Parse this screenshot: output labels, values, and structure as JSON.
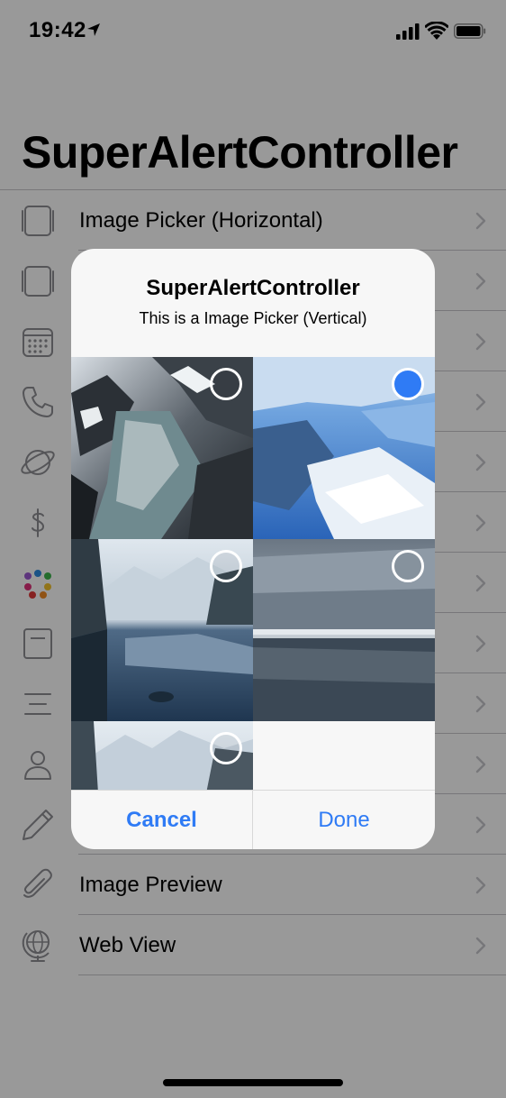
{
  "status_bar": {
    "time": "19:42"
  },
  "nav": {
    "title": "SuperAlertController"
  },
  "list": [
    {
      "label": "Image Picker (Horizontal)",
      "icon": "square-stack-icon"
    },
    {
      "label": "",
      "icon": "square-stack-icon"
    },
    {
      "label": "",
      "icon": "calendar-icon"
    },
    {
      "label": "",
      "icon": "phone-icon"
    },
    {
      "label": "",
      "icon": "planet-icon"
    },
    {
      "label": "",
      "icon": "dollar-icon"
    },
    {
      "label": "",
      "icon": "color-dots-icon"
    },
    {
      "label": "",
      "icon": "note-icon"
    },
    {
      "label": "",
      "icon": "text-lines-icon"
    },
    {
      "label": "",
      "icon": "person-icon"
    },
    {
      "label": "",
      "icon": "pencil-icon"
    },
    {
      "label": "Image Preview",
      "icon": "paperclip-icon"
    },
    {
      "label": "Web View",
      "icon": "globe-icon"
    }
  ],
  "alert": {
    "title": "SuperAlertController",
    "message": "This is a Image Picker (Vertical)",
    "images": [
      {
        "name": "glacier-fjord",
        "selected": false
      },
      {
        "name": "blue-glacier-aerial",
        "selected": true
      },
      {
        "name": "mountain-lake-reflection",
        "selected": false
      },
      {
        "name": "snowy-forest-lake",
        "selected": false
      },
      {
        "name": "snowy-mountain-range",
        "selected": false
      }
    ],
    "cancel_label": "Cancel",
    "done_label": "Done"
  },
  "colors": {
    "accent": "#2f7bf5",
    "dim_overlay": "rgba(0,0,0,0.40)",
    "icon_gray": "#8e8e93"
  }
}
